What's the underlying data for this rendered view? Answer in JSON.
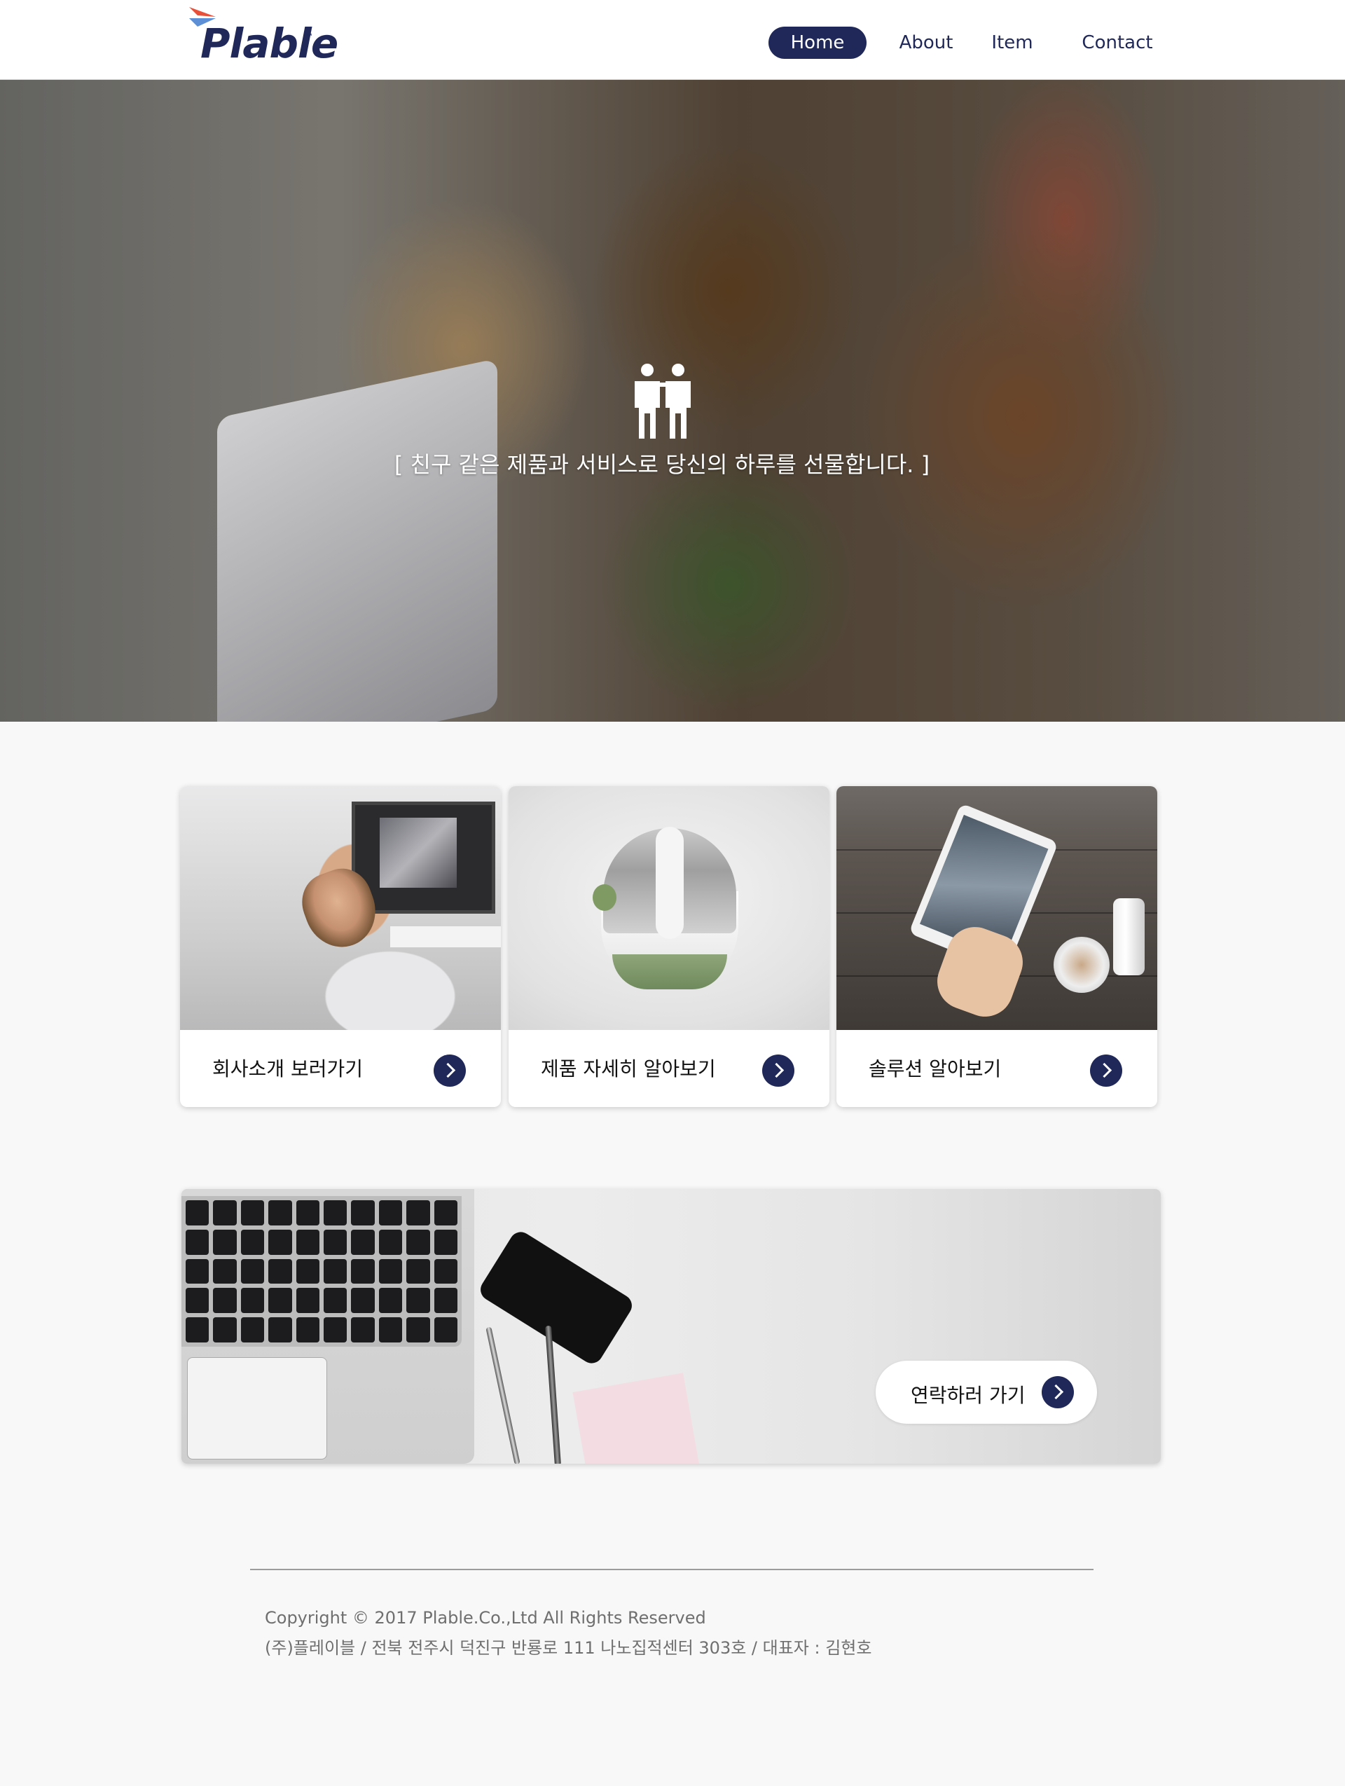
{
  "brand": {
    "name": "Plable",
    "tm": "™"
  },
  "nav": {
    "home": "Home",
    "about": "About",
    "item": "Item",
    "contact": "Contact"
  },
  "hero": {
    "tagline": "[ 친구 같은 제품과 서비스로 당신의 하루를 선물합니다. ]",
    "icon": "people-icon"
  },
  "cards": [
    {
      "label": "회사소개 보러가기",
      "icon": "chevron-right-icon"
    },
    {
      "label": "제품 자세히 알아보기",
      "icon": "chevron-right-icon"
    },
    {
      "label": "솔루션 알아보기",
      "icon": "chevron-right-icon"
    }
  ],
  "banner": {
    "cta_label": "연락하러 가기",
    "icon": "chevron-right-icon"
  },
  "footer": {
    "copyright": "Copyright © 2017 Plable.Co.,Ltd All Rights Reserved",
    "address": "(주)플레이블 / 전북 전주시 덕진구 반룡로 111 나노집적센터 303호 / 대표자 : 김현호"
  },
  "colors": {
    "accent": "#1f2858",
    "logo_red": "#e8503a",
    "logo_blue": "#5c8fd6",
    "background": "#f8f8f8"
  }
}
